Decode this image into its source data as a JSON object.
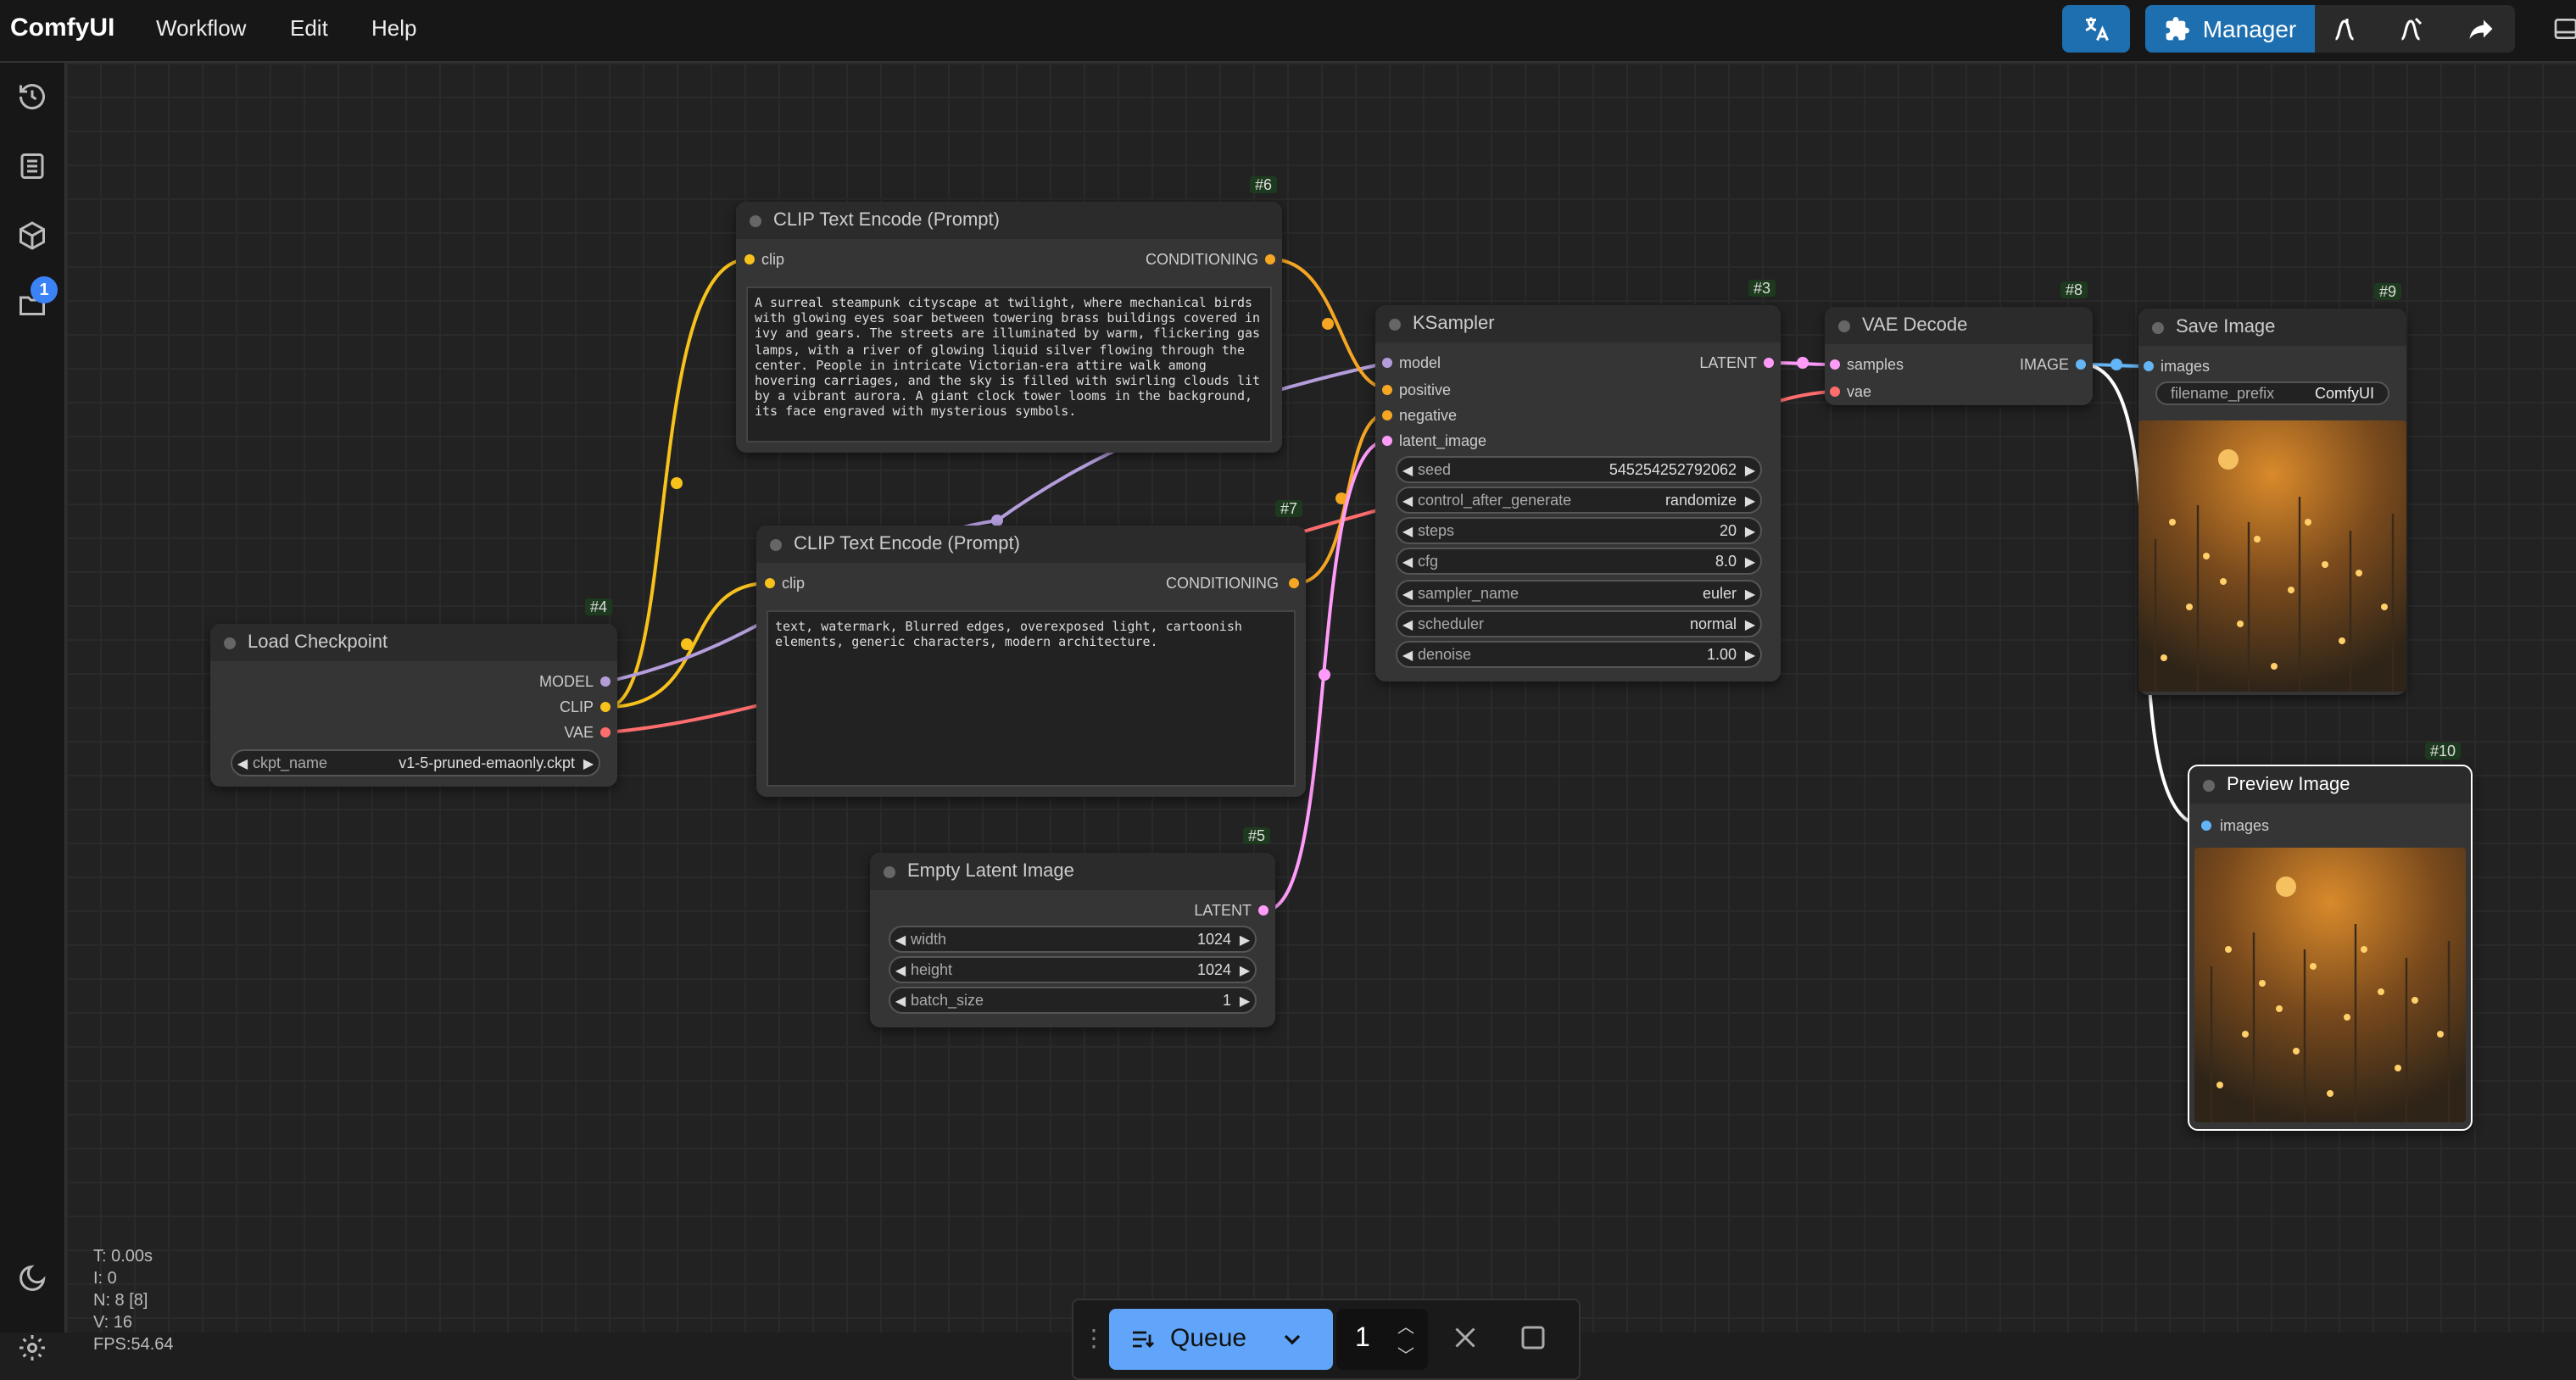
{
  "app": {
    "name": "ComfyUI"
  },
  "menu": [
    "Workflow",
    "Edit",
    "Help"
  ],
  "toolbar": {
    "manager_label": "Manager"
  },
  "sidebar": {
    "badge_count": "1"
  },
  "nodes": {
    "clip_pos": {
      "id": "#6",
      "title": "CLIP Text Encode (Prompt)",
      "input": "clip",
      "output": "CONDITIONING",
      "text": "A surreal steampunk cityscape at twilight, where mechanical birds with glowing eyes soar between towering brass buildings covered in ivy and gears. The streets are illuminated by warm, flickering gas lamps, with a river of glowing liquid silver flowing through the center. People in intricate Victorian-era attire walk among hovering carriages, and the sky is filled with swirling clouds lit by a vibrant aurora. A giant clock tower looms in the background, its face engraved with mysterious symbols."
    },
    "clip_neg": {
      "id": "#7",
      "title": "CLIP Text Encode (Prompt)",
      "input": "clip",
      "output": "CONDITIONING",
      "text": "text, watermark, Blurred edges, overexposed light, cartoonish elements, generic characters, modern architecture."
    },
    "checkpoint": {
      "id": "#4",
      "title": "Load Checkpoint",
      "outputs": [
        "MODEL",
        "CLIP",
        "VAE"
      ],
      "ckpt_label": "ckpt_name",
      "ckpt_value": "v1-5-pruned-emaonly.ckpt"
    },
    "ksampler": {
      "id": "#3",
      "title": "KSampler",
      "inputs": [
        "model",
        "positive",
        "negative",
        "latent_image"
      ],
      "output": "LATENT",
      "widgets": [
        {
          "label": "seed",
          "value": "545254252792062"
        },
        {
          "label": "control_after_generate",
          "value": "randomize"
        },
        {
          "label": "steps",
          "value": "20"
        },
        {
          "label": "cfg",
          "value": "8.0"
        },
        {
          "label": "sampler_name",
          "value": "euler"
        },
        {
          "label": "scheduler",
          "value": "normal"
        },
        {
          "label": "denoise",
          "value": "1.00"
        }
      ]
    },
    "vae": {
      "id": "#8",
      "title": "VAE Decode",
      "inputs": [
        "samples",
        "vae"
      ],
      "output": "IMAGE"
    },
    "save": {
      "id": "#9",
      "title": "Save Image",
      "input": "images",
      "prefix_label": "filename_prefix",
      "prefix_value": "ComfyUI"
    },
    "preview": {
      "id": "#10",
      "title": "Preview Image",
      "input": "images"
    },
    "latent": {
      "id": "#5",
      "title": "Empty Latent Image",
      "output": "LATENT",
      "widgets": [
        {
          "label": "width",
          "value": "1024"
        },
        {
          "label": "height",
          "value": "1024"
        },
        {
          "label": "batch_size",
          "value": "1"
        }
      ]
    }
  },
  "stats": {
    "t": "T: 0.00s",
    "i": "I: 0",
    "n": "N: 8 [8]",
    "v": "V: 16",
    "fps": "FPS:54.64"
  },
  "queue": {
    "label": "Queue",
    "count": "1"
  },
  "colors": {
    "clip": "#f8c21c",
    "model": "#b39ddb",
    "conditioning": "#f5a623",
    "vae": "#ff6e6e",
    "latent": "#ff9cf9",
    "image": "#64b5f6",
    "accent": "#3b82f6"
  }
}
